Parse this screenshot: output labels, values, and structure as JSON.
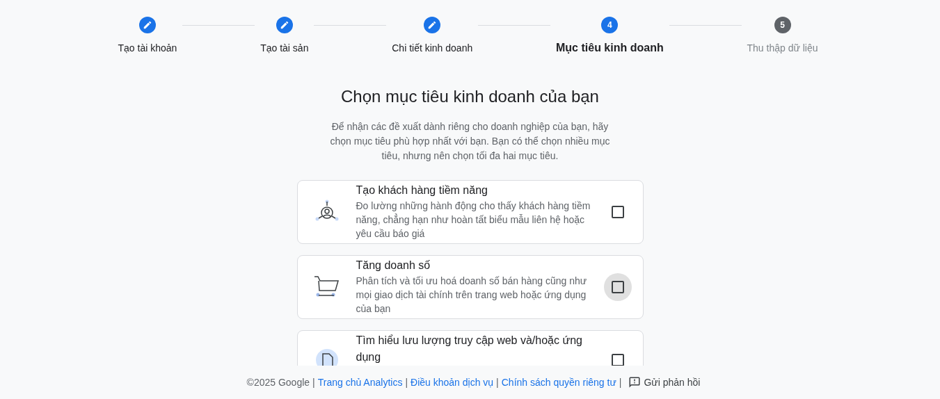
{
  "steps": [
    {
      "label": "Tạo tài khoản",
      "kind": "done"
    },
    {
      "label": "Tạo tài sản",
      "kind": "done"
    },
    {
      "label": "Chi tiết kinh doanh",
      "kind": "done"
    },
    {
      "label": "Mục tiêu kinh doanh",
      "kind": "current",
      "number": "4"
    },
    {
      "label": "Thu thập dữ liệu",
      "kind": "upcoming",
      "number": "5"
    }
  ],
  "heading": "Chọn mục tiêu kinh doanh của bạn",
  "intro": "Để nhận các đề xuất dành riêng cho doanh nghiệp của bạn, hãy chọn mục tiêu phù hợp nhất với bạn. Bạn có thể chọn nhiều mục tiêu, nhưng nên chọn tối đa hai mục tiêu.",
  "objectives": [
    {
      "kind": "leads",
      "title": "Tạo khách hàng tiềm năng",
      "description": "Đo lường những hành động cho thấy khách hàng tiềm năng, chẳng hạn như hoàn tất biểu mẫu liên hệ hoặc yêu cầu báo giá",
      "checked": false,
      "hovered": false
    },
    {
      "kind": "cart",
      "title": "Tăng doanh số",
      "description": "Phân tích và tối ưu hoá doanh số bán hàng cũng như mọi giao dịch tài chính trên trang web hoặc ứng dụng của bạn",
      "checked": false,
      "hovered": true
    },
    {
      "kind": "traffic",
      "title": "Tìm hiểu lưu lượng truy cập web và/hoặc ứng dụng",
      "checked": false,
      "hovered": false
    }
  ],
  "footer": [
    {
      "kind": "text",
      "text": "©2025 Google"
    },
    {
      "kind": "separator",
      "text": "|"
    },
    {
      "kind": "link",
      "text": "Trang chủ Analytics"
    },
    {
      "kind": "separator",
      "text": "|"
    },
    {
      "kind": "link",
      "text": "Điều khoản dịch vụ"
    },
    {
      "kind": "separator",
      "text": "|"
    },
    {
      "kind": "link",
      "text": "Chính sách quyền riêng tư"
    },
    {
      "kind": "separator",
      "text": "|"
    },
    {
      "kind": "feedback",
      "text": "Gửi phản hồi"
    }
  ]
}
